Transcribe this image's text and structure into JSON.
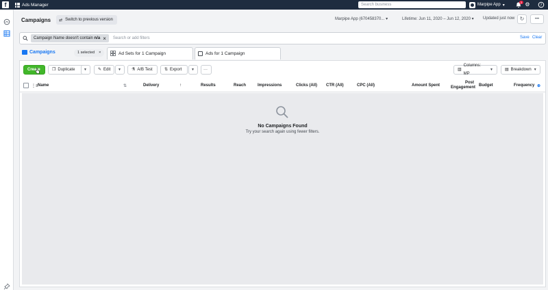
{
  "topbar": {
    "logo": "f",
    "app_title": "Ads Manager",
    "search_placeholder": "Search business",
    "account_name": "Marpipe App",
    "notification_count": "3"
  },
  "header": {
    "title": "Campaigns",
    "switch_label": "Switch to previous version",
    "account_select": "Marpipe App (670458370...",
    "date_range": "Lifetime: Jun 11, 2020 – Jun 12, 2020",
    "updated": "Updated just now",
    "more": "•••"
  },
  "filter": {
    "chip_prefix": "Campaign Name doesn't contain",
    "chip_value": "n/a",
    "placeholder": "Search or add filters",
    "save": "Save",
    "clear": "Clear"
  },
  "tabs": {
    "campaigns": "Campaigns",
    "selected": "1 selected",
    "adsets": "Ad Sets for 1 Campaign",
    "ads": "Ads for 1 Campaign"
  },
  "toolbar": {
    "create": "Create",
    "duplicate": "Duplicate",
    "edit": "Edit",
    "ab_test": "A/B Test",
    "export": "Export",
    "more": "···",
    "columns": "Columns: MP",
    "breakdown": "Breakdown"
  },
  "table": {
    "columns": {
      "name": "Name",
      "delivery": "Delivery",
      "results": "Results",
      "reach": "Reach",
      "impressions": "Impressions",
      "clicks": "Clicks (All)",
      "ctr": "CTR (All)",
      "cpc": "CPC (All)",
      "amount_spent": "Amount Spent",
      "post_engagement_1": "Post",
      "post_engagement_2": "Engagement",
      "budget": "Budget",
      "frequency": "Frequency"
    },
    "empty_title": "No Campaigns Found",
    "empty_subtitle": "Try your search again using fewer filters."
  },
  "colors": {
    "topbar": "#1e2c3f",
    "accent": "#1877f2",
    "create": "#42b72a",
    "empty_bg": "#e9eaed"
  }
}
